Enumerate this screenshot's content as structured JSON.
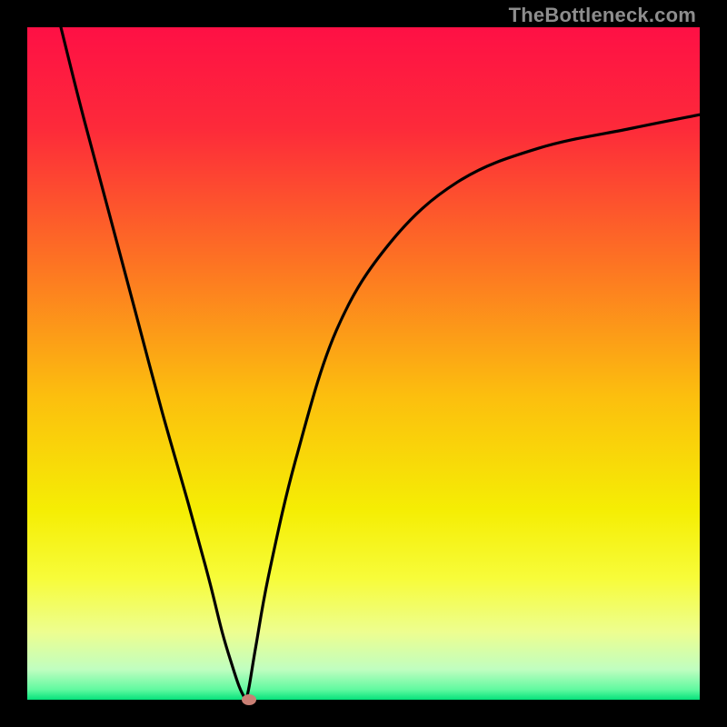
{
  "watermark": "TheBottleneck.com",
  "chart_data": {
    "type": "line",
    "title": "",
    "xlabel": "",
    "ylabel": "",
    "xlim": [
      0,
      100
    ],
    "ylim": [
      0,
      100
    ],
    "series": [
      {
        "name": "bottleneck-curve",
        "x": [
          5,
          8,
          12,
          16,
          20,
          24,
          27,
          29,
          30.5,
          31.5,
          32.2,
          32.5,
          33,
          34,
          36,
          40,
          46,
          54,
          64,
          76,
          90,
          100
        ],
        "values": [
          100,
          88,
          73,
          58,
          43,
          29,
          18,
          10,
          5,
          2,
          0.5,
          0,
          2,
          8,
          19,
          36,
          55,
          68,
          77,
          82,
          85,
          87
        ]
      }
    ],
    "annotations": [
      {
        "name": "min-point-marker",
        "x": 33,
        "y": 0
      }
    ],
    "gradient_stops": [
      {
        "offset": 0,
        "color": "#fe1045"
      },
      {
        "offset": 0.15,
        "color": "#fd2a3a"
      },
      {
        "offset": 0.35,
        "color": "#fd7323"
      },
      {
        "offset": 0.55,
        "color": "#fcbf0e"
      },
      {
        "offset": 0.72,
        "color": "#f5ee04"
      },
      {
        "offset": 0.82,
        "color": "#f7fc3a"
      },
      {
        "offset": 0.9,
        "color": "#edfe90"
      },
      {
        "offset": 0.955,
        "color": "#c0fec0"
      },
      {
        "offset": 0.985,
        "color": "#60f9a0"
      },
      {
        "offset": 1.0,
        "color": "#05e27b"
      }
    ]
  }
}
